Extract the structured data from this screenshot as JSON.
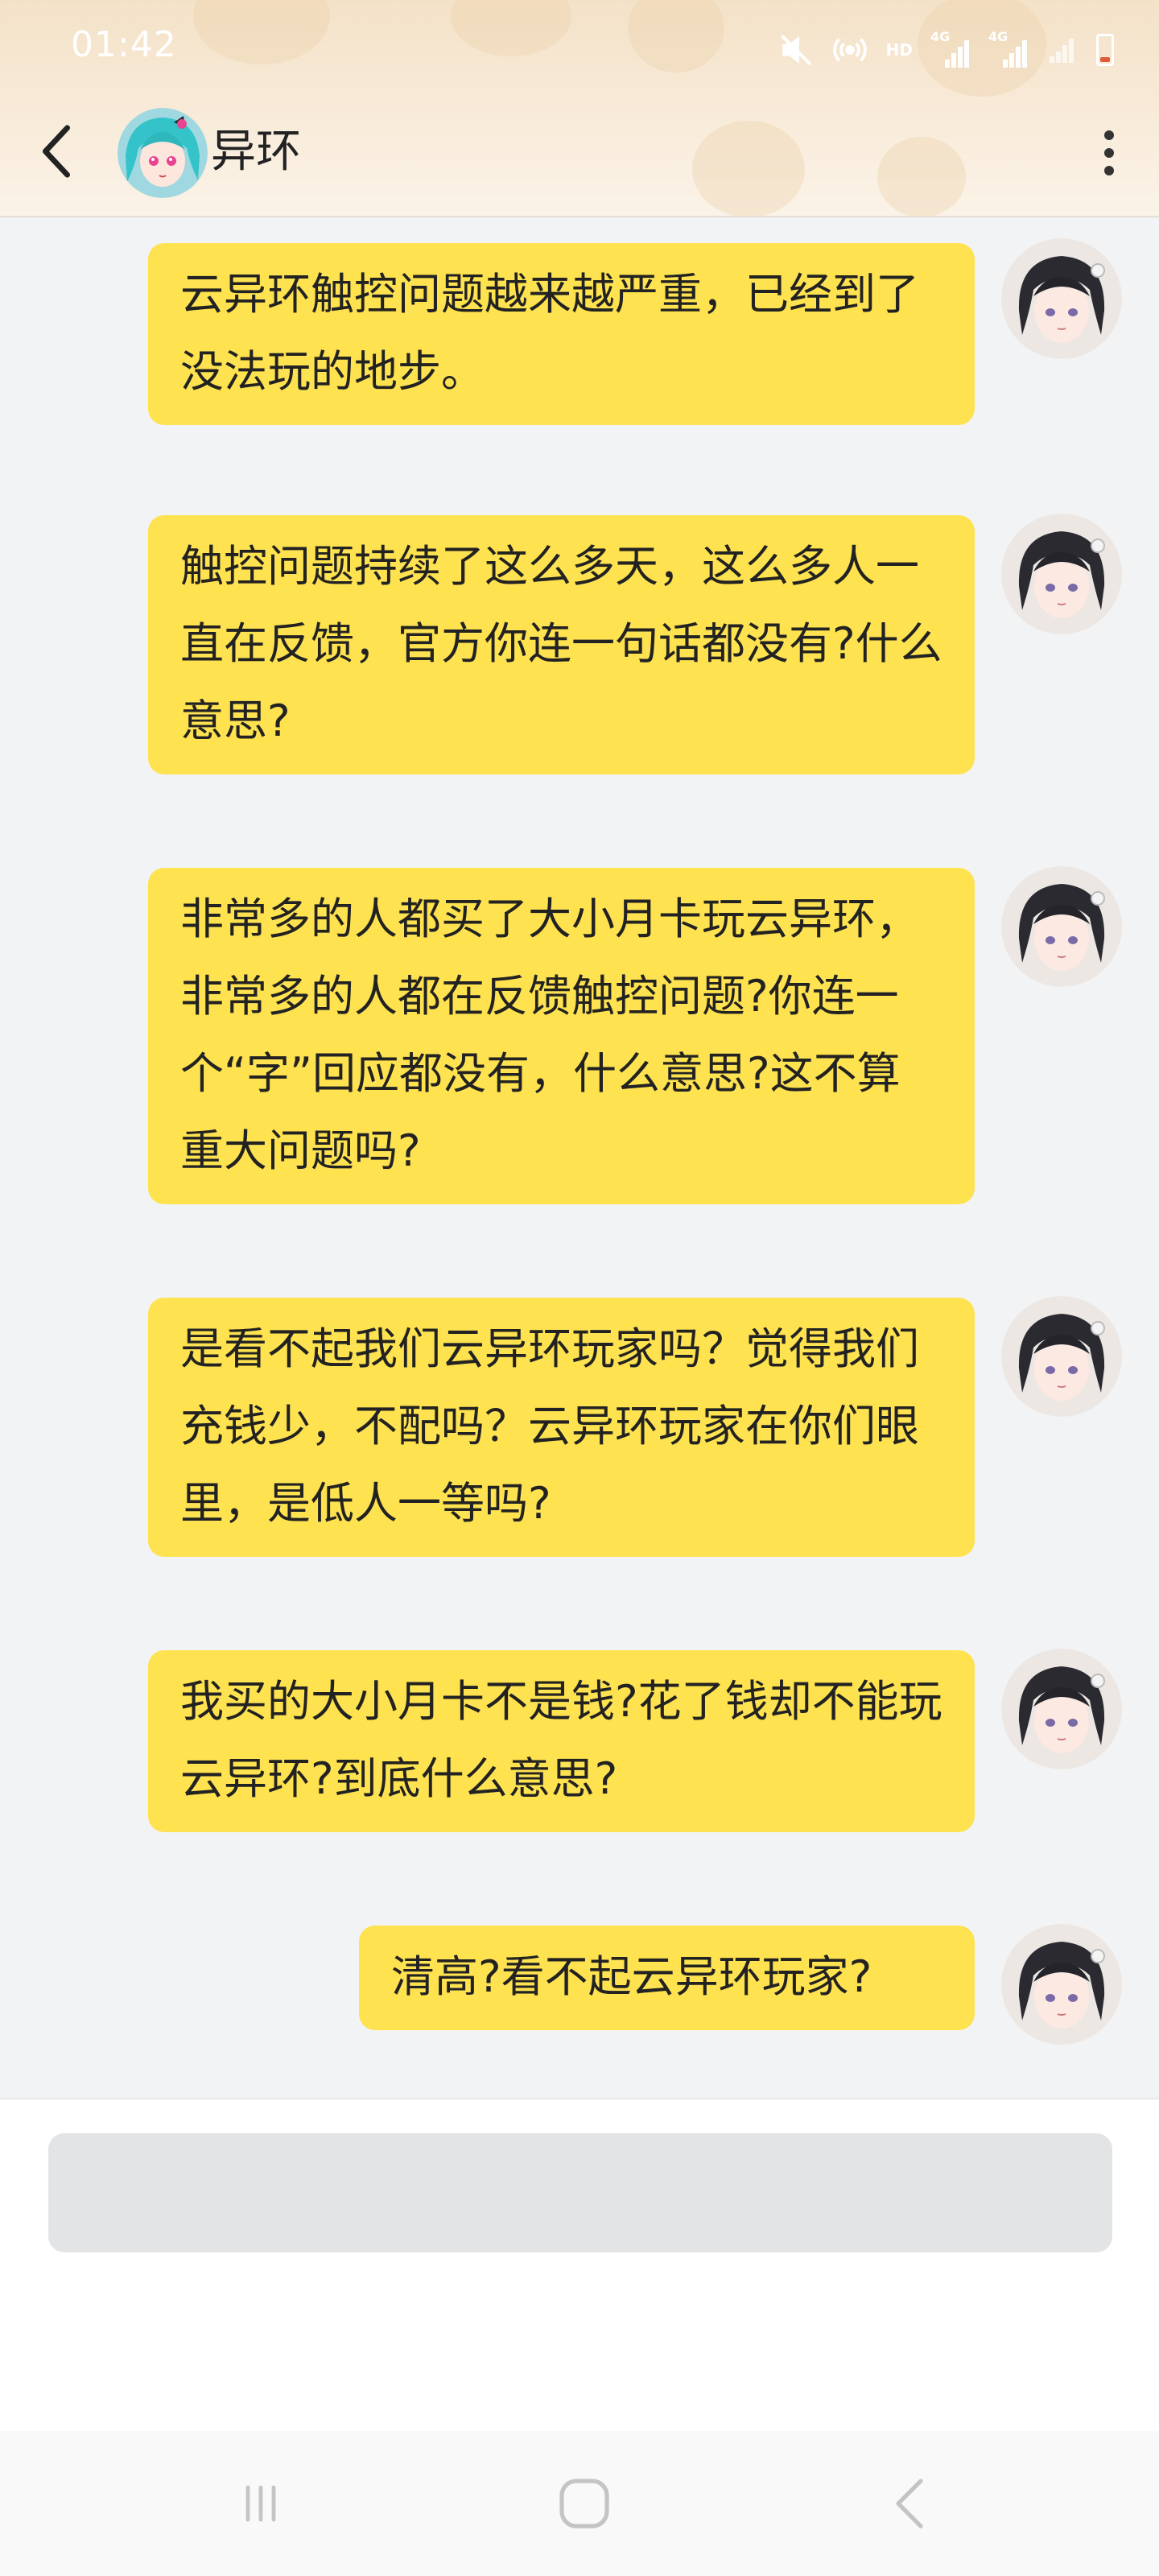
{
  "status_bar": {
    "time": "01:42",
    "icons": [
      "mute-icon",
      "hotspot-icon",
      "hd-icon",
      "signal-4g-icon",
      "signal-4g-icon",
      "wifi-signal-icon",
      "battery-low-icon"
    ],
    "hd_label": "HD",
    "net1_label": "4G",
    "net2_label": "4G",
    "battery_color": "#e05a3b"
  },
  "header": {
    "back_icon": "chevron-left-icon",
    "title": "异环",
    "more_icon": "more-vertical-icon"
  },
  "messages": [
    {
      "text": "云异环触控问题越来越严重，已经到了没法玩的地步。",
      "sender": "self"
    },
    {
      "text": "触控问题持续了这么多天，这么多人一直在反馈，官方你连一句话都没有?什么意思?",
      "sender": "self"
    },
    {
      "text": "非常多的人都买了大小月卡玩云异环，非常多的人都在反馈触控问题?你连一个“字”回应都没有，什么意思?这不算重大问题吗?",
      "sender": "self"
    },
    {
      "text": "是看不起我们云异环玩家吗？觉得我们充钱少，不配吗？云异环玩家在你们眼里，是低人一等吗?",
      "sender": "self"
    },
    {
      "text": "我买的大小月卡不是钱?花了钱却不能玩云异环?到底什么意思?",
      "sender": "self"
    },
    {
      "text": "清高?看不起云异环玩家?",
      "sender": "self"
    }
  ],
  "input": {
    "value": "",
    "placeholder": ""
  },
  "nav": {
    "recent": "recent-apps-icon",
    "home": "home-icon",
    "back": "back-icon"
  },
  "colors": {
    "bubble": "#fee250",
    "background": "#f2f3f5",
    "header": "#f8ebd9"
  }
}
